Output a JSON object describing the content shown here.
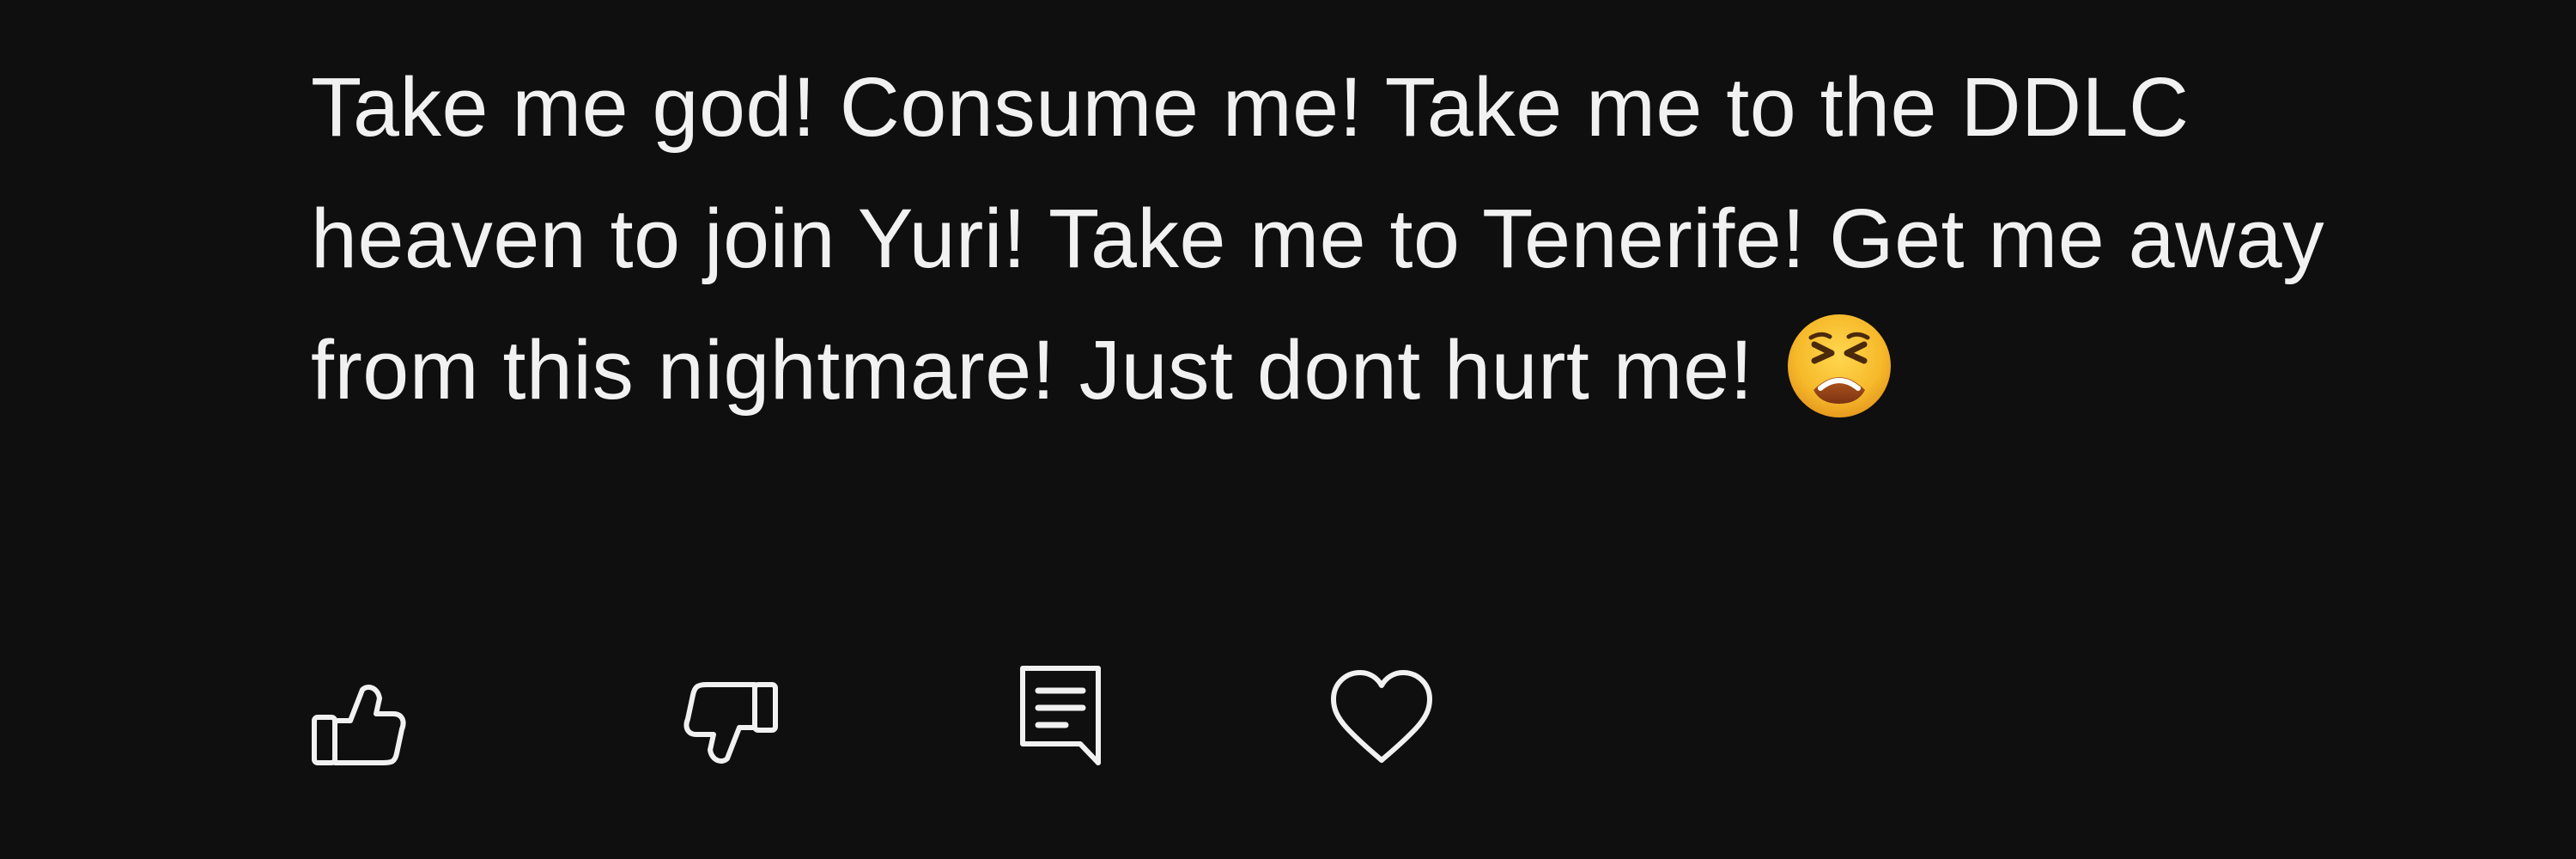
{
  "comment": {
    "text": "Take me god! Consume me! Take me to the DDLC heaven to join Yuri! Take me to Tenerife! Get me away from this nightmare! Just dont hurt me!",
    "emoji": "tired-face-emoji"
  },
  "actions": {
    "like": "thumbs-up-icon",
    "dislike": "thumbs-down-icon",
    "reply": "reply-comment-icon",
    "heart": "heart-icon"
  },
  "colors": {
    "background": "#0f0f0f",
    "text": "#f1f1f1",
    "icon": "#f1f1f1"
  }
}
